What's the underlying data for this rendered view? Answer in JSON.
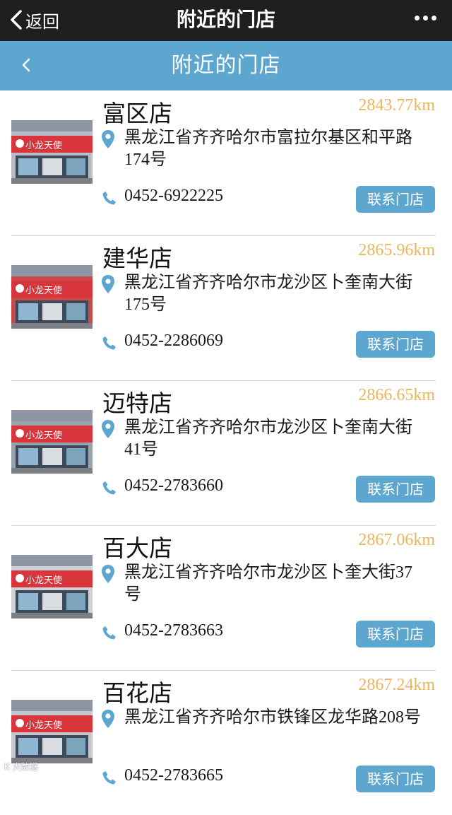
{
  "wechat_bar": {
    "back_label": "返回",
    "title": "附近的门店"
  },
  "header": {
    "title": "附近的门店"
  },
  "stores": [
    {
      "name": "富区店",
      "distance": "2843.77km",
      "address": "黑龙江省齐齐哈尔市富拉尔基区和平路174号",
      "phone": "0452-6922225",
      "contact_label": "联系门店"
    },
    {
      "name": "建华店",
      "distance": "2865.96km",
      "address": "黑龙江省齐齐哈尔市龙沙区卜奎南大街175号",
      "phone": "0452-2286069",
      "contact_label": "联系门店"
    },
    {
      "name": "迈特店",
      "distance": "2866.65km",
      "address": "黑龙江省齐齐哈尔市龙沙区卜奎南大街41号",
      "phone": "0452-2783660",
      "contact_label": "联系门店"
    },
    {
      "name": "百大店",
      "distance": "2867.06km",
      "address": "黑龙江省齐齐哈尔市龙沙区卜奎大街37号",
      "phone": "0452-2783663",
      "contact_label": "联系门店"
    },
    {
      "name": "百花店",
      "distance": "2867.24km",
      "address": "黑龙江省齐齐哈尔市铁锋区龙华路208号",
      "phone": "0452-2783665",
      "contact_label": "联系门店"
    }
  ],
  "storefront_sign_text": "小龙天使",
  "watermark": "K 大数据",
  "colors": {
    "accent": "#5da6cf",
    "distance": "#ebb55b",
    "topbar": "#1f1f1f",
    "sign_red": "#d8353c"
  }
}
